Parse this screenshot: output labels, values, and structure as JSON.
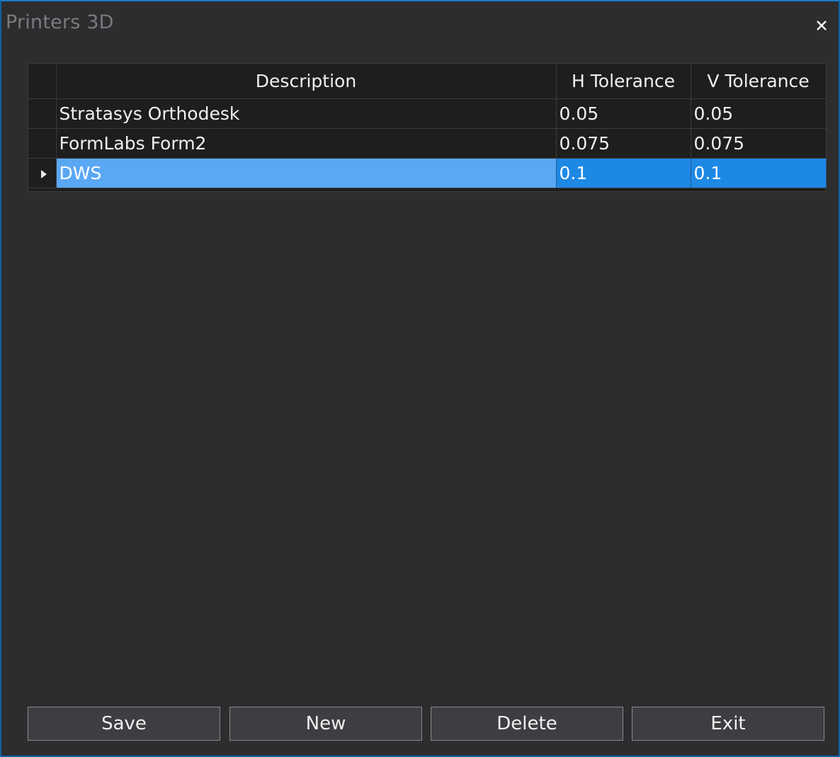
{
  "window": {
    "title": "Printers 3D",
    "close_icon": "close-icon"
  },
  "grid": {
    "columns": [
      "Description",
      "H Tolerance",
      "V Tolerance"
    ],
    "rows": [
      {
        "description": "Stratasys Orthodesk",
        "h_tolerance": "0.05",
        "v_tolerance": "0.05",
        "selected": false
      },
      {
        "description": "FormLabs Form2",
        "h_tolerance": "0.075",
        "v_tolerance": "0.075",
        "selected": false
      },
      {
        "description": "DWS",
        "h_tolerance": "0.1",
        "v_tolerance": "0.1",
        "selected": true
      }
    ],
    "current_row_icon": "row-pointer-icon"
  },
  "buttons": {
    "save": "Save",
    "new": "New",
    "delete": "Delete",
    "exit": "Exit"
  },
  "colors": {
    "background": "#2d2d30",
    "grid_background": "#1e1e1e",
    "selection": "#4ea1f3",
    "window_border": "#0e639c"
  }
}
